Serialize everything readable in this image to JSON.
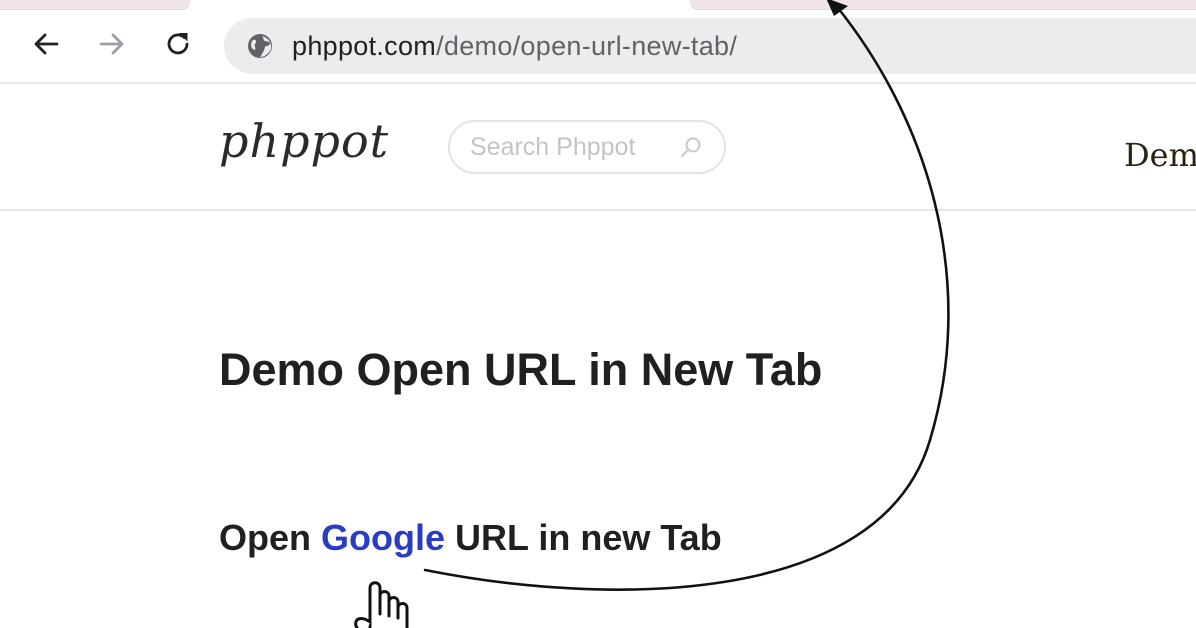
{
  "browser": {
    "back_icon": "arrow-left-icon",
    "forward_icon": "arrow-right-icon",
    "reload_icon": "reload-icon",
    "site_info_icon": "globe-icon",
    "url_host": "phppot.com",
    "url_path": "/demo/open-url-new-tab/"
  },
  "site": {
    "logo": "phppot",
    "search_placeholder": "Search Phppot",
    "search_icon": "magnifier-icon",
    "nav_demo_label": "Demo"
  },
  "main": {
    "title": "Demo Open URL in New Tab",
    "line_prefix": "Open ",
    "link_text": "Google",
    "line_suffix": " URL in new Tab"
  },
  "colors": {
    "link": "#2a3bc4",
    "omnibox_bg": "#ececee",
    "heading": "#202020"
  }
}
